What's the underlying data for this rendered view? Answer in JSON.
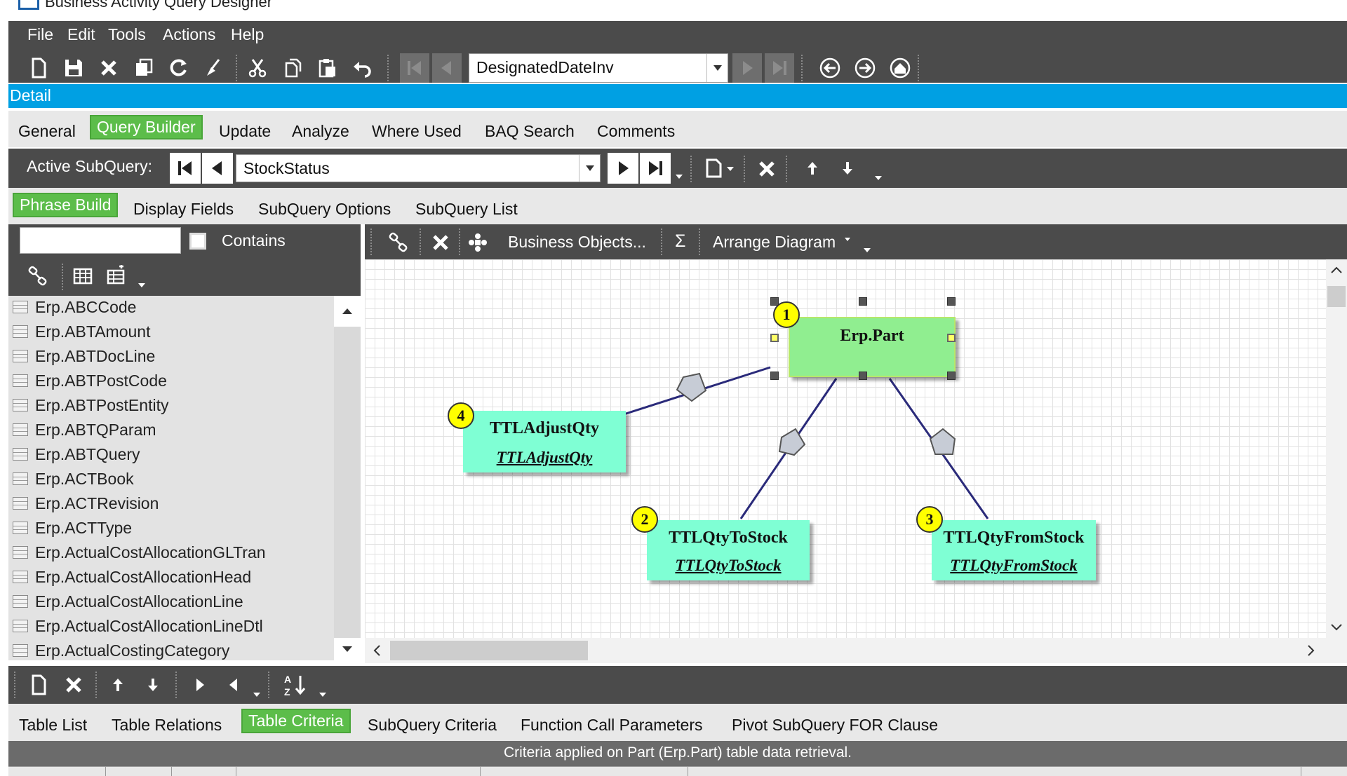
{
  "window": {
    "title": "Business Activity Query Designer"
  },
  "menu": [
    "File",
    "Edit",
    "Tools",
    "Actions",
    "Help"
  ],
  "toolbar": {
    "query_combo_value": "DesignatedDateInv"
  },
  "detail_label": "Detail",
  "main_tabs": [
    "General",
    "Query Builder",
    "Update",
    "Analyze",
    "Where Used",
    "BAQ Search",
    "Comments"
  ],
  "subquery": {
    "label": "Active SubQuery:",
    "value": "StockStatus"
  },
  "sub_tabs": [
    "Phrase Build",
    "Display Fields",
    "SubQuery Options",
    "SubQuery List"
  ],
  "filter": {
    "value": "",
    "contains_label": "Contains"
  },
  "table_list": [
    "Erp.ABCCode",
    "Erp.ABTAmount",
    "Erp.ABTDocLine",
    "Erp.ABTPostCode",
    "Erp.ABTPostEntity",
    "Erp.ABTQParam",
    "Erp.ABTQuery",
    "Erp.ACTBook",
    "Erp.ACTRevision",
    "Erp.ACTType",
    "Erp.ActualCostAllocationGLTran",
    "Erp.ActualCostAllocationHead",
    "Erp.ActualCostAllocationLine",
    "Erp.ActualCostAllocationLineDtl",
    "Erp.ActualCostingCategory"
  ],
  "diagram_toolbar": {
    "business_objects": "Business Objects...",
    "sigma": "Σ",
    "arrange": "Arrange Diagram"
  },
  "diagram": {
    "nodes": [
      {
        "badge": "1",
        "title": "Erp.Part",
        "subtitle": ""
      },
      {
        "badge": "4",
        "title": "TTLAdjustQty",
        "subtitle": "TTLAdjustQty"
      },
      {
        "badge": "2",
        "title": "TTLQtyToStock",
        "subtitle": "TTLQtyToStock"
      },
      {
        "badge": "3",
        "title": "TTLQtyFromStock",
        "subtitle": "TTLQtyFromStock"
      }
    ],
    "colors": {
      "selected_node": "#90ee90",
      "node": "#7fffd4",
      "badge": "#ffff00",
      "link": "#2a2a7a"
    }
  },
  "bottom_tabs": [
    "Table List",
    "Table Relations",
    "Table Criteria",
    "SubQuery Criteria",
    "Function Call Parameters",
    "Pivot SubQuery FOR Clause"
  ],
  "criteria_info": "Criteria applied on Part (Erp.Part)  table data retrieval."
}
